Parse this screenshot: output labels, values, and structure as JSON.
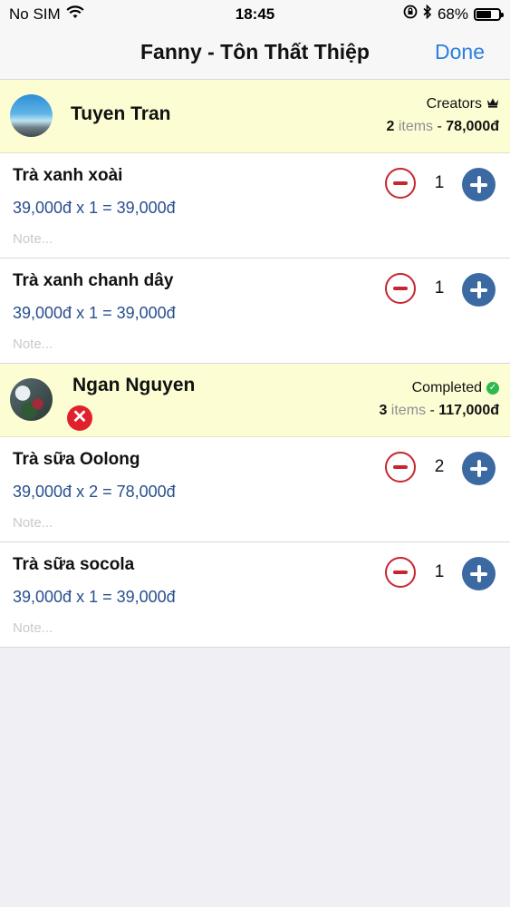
{
  "status_bar": {
    "carrier": "No SIM",
    "time": "18:45",
    "battery": "68%",
    "battery_level": 0.68
  },
  "nav": {
    "title": "Fanny - Tôn Thất Thiệp",
    "done": "Done"
  },
  "groups": [
    {
      "user": "Tuyen Tran",
      "role": "Creators",
      "item_count": "2",
      "items_word": "items",
      "separator": "-",
      "total": "78,000đ",
      "items": [
        {
          "name": "Trà xanh xoài",
          "price_line": "39,000đ x 1 = 39,000đ",
          "note_placeholder": "Note...",
          "qty": "1"
        },
        {
          "name": "Trà xanh chanh dây",
          "price_line": "39,000đ x 1 = 39,000đ",
          "note_placeholder": "Note...",
          "qty": "1"
        }
      ]
    },
    {
      "user": "Ngan Nguyen",
      "role": "Completed",
      "item_count": "3",
      "items_word": "items",
      "separator": "-",
      "total": "117,000đ",
      "items": [
        {
          "name": "Trà sữa Oolong",
          "price_line": "39,000đ x 2 = 78,000đ",
          "note_placeholder": "Note...",
          "qty": "2"
        },
        {
          "name": "Trà sữa socola",
          "price_line": "39,000đ x 1 = 39,000đ",
          "note_placeholder": "Note...",
          "qty": "1"
        }
      ]
    }
  ],
  "colors": {
    "accent": "#2a7fe0",
    "header_bg": "#fdfdd4",
    "price": "#284e8f",
    "minus": "#c8252f",
    "plus": "#3b6aa3",
    "remove": "#e0212b",
    "completed": "#2fb84d"
  }
}
